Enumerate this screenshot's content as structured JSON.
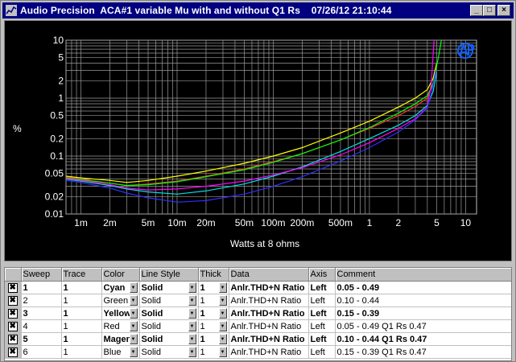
{
  "window": {
    "title": "Audio Precision  ACA#1 variable Mu with and without Q1 Rs    07/26/12 21:10:44",
    "icon": "audio-precision-app-icon",
    "buttons": {
      "minimize": "_",
      "maximize": "□",
      "close": "×"
    }
  },
  "chart_data": {
    "type": "line",
    "xlabel": "Watts at 8 ohms",
    "ylabel": "%",
    "x_scale": "log",
    "y_scale": "log",
    "xlim": [
      0.0007,
      13
    ],
    "ylim": [
      0.01,
      10
    ],
    "grid": true,
    "legend": "none",
    "x_ticks": [
      {
        "v": 0.001,
        "label": "1m"
      },
      {
        "v": 0.002,
        "label": "2m"
      },
      {
        "v": 0.005,
        "label": "5m"
      },
      {
        "v": 0.01,
        "label": "10m"
      },
      {
        "v": 0.02,
        "label": "20m"
      },
      {
        "v": 0.05,
        "label": "50m"
      },
      {
        "v": 0.1,
        "label": "100m"
      },
      {
        "v": 0.2,
        "label": "200m"
      },
      {
        "v": 0.5,
        "label": "500m"
      },
      {
        "v": 1,
        "label": "1"
      },
      {
        "v": 2,
        "label": "2"
      },
      {
        "v": 5,
        "label": "5"
      },
      {
        "v": 10,
        "label": "10"
      }
    ],
    "y_ticks": [
      {
        "v": 10,
        "label": "10"
      },
      {
        "v": 5,
        "label": "5"
      },
      {
        "v": 2,
        "label": "2"
      },
      {
        "v": 1,
        "label": "1"
      },
      {
        "v": 0.5,
        "label": "0.5"
      },
      {
        "v": 0.2,
        "label": "0.2"
      },
      {
        "v": 0.1,
        "label": "0.1"
      },
      {
        "v": 0.05,
        "label": "0.05"
      },
      {
        "v": 0.02,
        "label": "0.02"
      },
      {
        "v": 0.01,
        "label": "0.01"
      }
    ],
    "series": [
      {
        "color": "#ffff00",
        "points": [
          [
            0.0007,
            0.045
          ],
          [
            0.001,
            0.042
          ],
          [
            0.002,
            0.038
          ],
          [
            0.003,
            0.035
          ],
          [
            0.005,
            0.038
          ],
          [
            0.01,
            0.045
          ],
          [
            0.02,
            0.055
          ],
          [
            0.05,
            0.075
          ],
          [
            0.1,
            0.1
          ],
          [
            0.2,
            0.14
          ],
          [
            0.5,
            0.25
          ],
          [
            1,
            0.4
          ],
          [
            2,
            0.7
          ],
          [
            3,
            1.0
          ],
          [
            4,
            1.4
          ],
          [
            4.6,
            2.2
          ],
          [
            5,
            4.0
          ]
        ]
      },
      {
        "color": "#ff3030",
        "points": [
          [
            0.0007,
            0.043
          ],
          [
            0.001,
            0.04
          ],
          [
            0.002,
            0.034
          ],
          [
            0.003,
            0.031
          ],
          [
            0.005,
            0.033
          ],
          [
            0.01,
            0.037
          ],
          [
            0.02,
            0.045
          ],
          [
            0.05,
            0.06
          ],
          [
            0.1,
            0.08
          ],
          [
            0.2,
            0.11
          ],
          [
            0.5,
            0.19
          ],
          [
            1,
            0.3
          ],
          [
            2,
            0.5
          ],
          [
            3,
            0.72
          ],
          [
            4,
            1.0
          ],
          [
            4.5,
            1.6
          ],
          [
            5,
            3.5
          ]
        ]
      },
      {
        "color": "#00ff00",
        "points": [
          [
            0.0007,
            0.042
          ],
          [
            0.001,
            0.039
          ],
          [
            0.002,
            0.034
          ],
          [
            0.003,
            0.031
          ],
          [
            0.005,
            0.032
          ],
          [
            0.01,
            0.036
          ],
          [
            0.02,
            0.044
          ],
          [
            0.05,
            0.058
          ],
          [
            0.1,
            0.078
          ],
          [
            0.2,
            0.11
          ],
          [
            0.5,
            0.19
          ],
          [
            1,
            0.31
          ],
          [
            2,
            0.55
          ],
          [
            3,
            0.8
          ],
          [
            4,
            1.1
          ],
          [
            4.6,
            1.8
          ],
          [
            5.2,
            5.0
          ],
          [
            5.6,
            10
          ]
        ]
      },
      {
        "color": "#00e0e0",
        "points": [
          [
            0.0007,
            0.04
          ],
          [
            0.001,
            0.037
          ],
          [
            0.002,
            0.031
          ],
          [
            0.003,
            0.027
          ],
          [
            0.005,
            0.024
          ],
          [
            0.01,
            0.022
          ],
          [
            0.02,
            0.025
          ],
          [
            0.05,
            0.033
          ],
          [
            0.1,
            0.045
          ],
          [
            0.2,
            0.065
          ],
          [
            0.5,
            0.12
          ],
          [
            1,
            0.2
          ],
          [
            2,
            0.34
          ],
          [
            3,
            0.5
          ],
          [
            4,
            0.75
          ],
          [
            4.6,
            1.3
          ],
          [
            5,
            2.8
          ]
        ]
      },
      {
        "color": "#ff00ff",
        "points": [
          [
            0.0007,
            0.041
          ],
          [
            0.001,
            0.038
          ],
          [
            0.002,
            0.032
          ],
          [
            0.003,
            0.028
          ],
          [
            0.005,
            0.026
          ],
          [
            0.01,
            0.027
          ],
          [
            0.02,
            0.03
          ],
          [
            0.05,
            0.037
          ],
          [
            0.1,
            0.047
          ],
          [
            0.2,
            0.063
          ],
          [
            0.5,
            0.105
          ],
          [
            1,
            0.17
          ],
          [
            2,
            0.3
          ],
          [
            3,
            0.44
          ],
          [
            4,
            0.7
          ],
          [
            4.4,
            1.8
          ],
          [
            4.7,
            10
          ]
        ]
      },
      {
        "color": "#3030ff",
        "points": [
          [
            0.0007,
            0.038
          ],
          [
            0.001,
            0.035
          ],
          [
            0.002,
            0.028
          ],
          [
            0.003,
            0.023
          ],
          [
            0.005,
            0.019
          ],
          [
            0.01,
            0.016
          ],
          [
            0.02,
            0.017
          ],
          [
            0.05,
            0.022
          ],
          [
            0.1,
            0.03
          ],
          [
            0.2,
            0.044
          ],
          [
            0.5,
            0.082
          ],
          [
            1,
            0.14
          ],
          [
            2,
            0.26
          ],
          [
            3,
            0.42
          ],
          [
            4,
            0.68
          ],
          [
            4.5,
            1.4
          ],
          [
            4.9,
            3.0
          ]
        ]
      }
    ]
  },
  "table": {
    "headers": [
      "",
      "Sweep",
      "Trace",
      "Color",
      "Line Style",
      "Thick",
      "Data",
      "Axis",
      "Comment"
    ],
    "rows": [
      {
        "sweep": "1",
        "trace": "1",
        "color": "Cyan",
        "style": "Solid",
        "thick": "1",
        "data": "Anlr.THD+N Ratio",
        "axis": "Left",
        "comment": "0.05 - 0.49",
        "bold": true
      },
      {
        "sweep": "2",
        "trace": "1",
        "color": "Green",
        "style": "Solid",
        "thick": "1",
        "data": "Anlr.THD+N Ratio",
        "axis": "Left",
        "comment": "0.10 - 0.44",
        "bold": false
      },
      {
        "sweep": "3",
        "trace": "1",
        "color": "Yellow",
        "style": "Solid",
        "thick": "1",
        "data": "Anlr.THD+N Ratio",
        "axis": "Left",
        "comment": "0.15 - 0.39",
        "bold": true
      },
      {
        "sweep": "4",
        "trace": "1",
        "color": "Red",
        "style": "Solid",
        "thick": "1",
        "data": "Anlr.THD+N Ratio",
        "axis": "Left",
        "comment": "0.05 - 0.49  Q1 Rs 0.47",
        "bold": false
      },
      {
        "sweep": "5",
        "trace": "1",
        "color": "Magenta",
        "style": "Solid",
        "thick": "1",
        "data": "Anlr.THD+N Ratio",
        "axis": "Left",
        "comment": "0.10 - 0.44  Q1 Rs 0.47",
        "bold": true
      },
      {
        "sweep": "6",
        "trace": "1",
        "color": "Blue",
        "style": "Solid",
        "thick": "1",
        "data": "Anlr.THD+N Ratio",
        "axis": "Left",
        "comment": "0.15 - 0.39  Q1 Rs 0.47",
        "bold": false
      }
    ],
    "delete_mark": "✖"
  },
  "logo": "ap-logo"
}
